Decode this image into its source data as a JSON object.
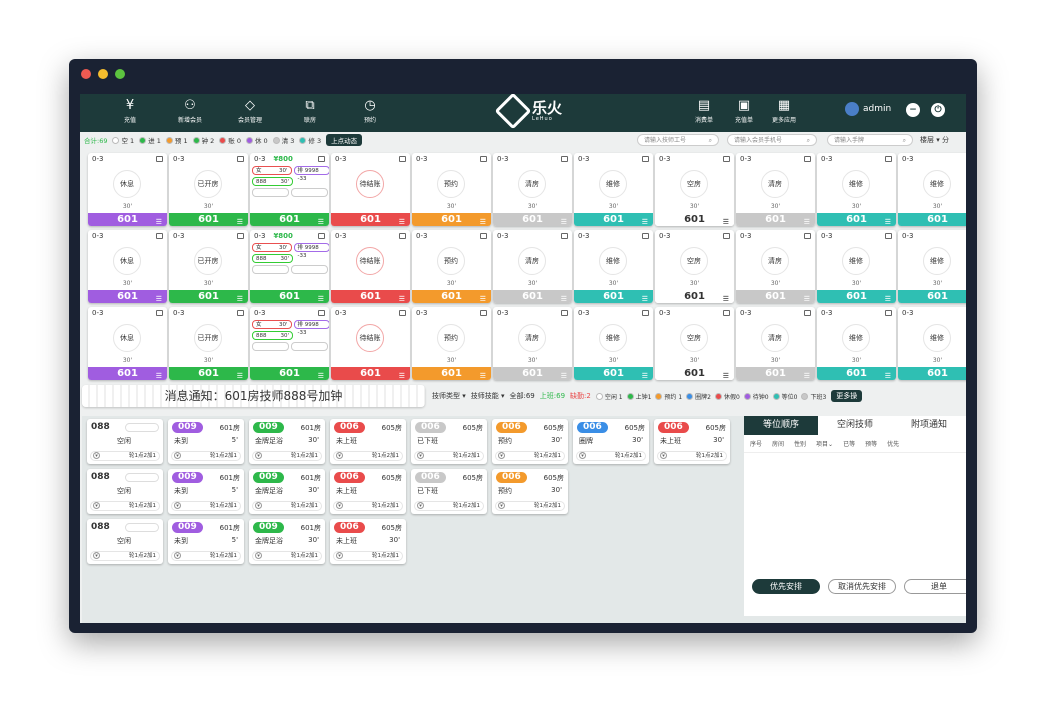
{
  "window": {
    "dot_colors": [
      "#ee5a52",
      "#f5bd2e",
      "#5cc33f"
    ]
  },
  "toolbar": [
    {
      "label": "充值",
      "icon": "yen-icon"
    },
    {
      "label": "新增会员",
      "icon": "add-user-icon"
    },
    {
      "label": "会员管理",
      "icon": "diamond-icon"
    },
    {
      "label": "联房",
      "icon": "link-rooms-icon"
    },
    {
      "label": "预约",
      "icon": "clock-icon"
    }
  ],
  "toolbar_right": [
    {
      "label": "消费单",
      "icon": "receipt-icon"
    },
    {
      "label": "充值单",
      "icon": "recharge-icon"
    },
    {
      "label": "更多应用",
      "icon": "grid-icon"
    }
  ],
  "logo": {
    "name": "乐火",
    "sub": "LeHuo"
  },
  "user": {
    "name": "admin"
  },
  "status_filter": {
    "total": "合计:69",
    "items": [
      {
        "label": "空 1",
        "color": "#ffffff"
      },
      {
        "label": "进 1",
        "color": "#2db84a"
      },
      {
        "label": "预 1",
        "color": "#f39a2c"
      },
      {
        "label": "钟 2",
        "color": "#2db84a"
      },
      {
        "label": "账 0",
        "color": "#e94b4b"
      },
      {
        "label": "休 0",
        "color": "#a05de0"
      },
      {
        "label": "清 3",
        "color": "#c8c8c8"
      },
      {
        "label": "修 3",
        "color": "#2fbfb3"
      }
    ],
    "dynamic": "上点动态"
  },
  "searches": {
    "tech_id": "请输入技师工号",
    "member_phone": "请输入会员手机号",
    "bracelet": "请输入手牌",
    "floor": "楼层",
    "extra": "分"
  },
  "room_rows": [
    [
      {
        "code": "0-3",
        "status": "休息",
        "dur": "30'",
        "room": "601",
        "color": "#a05de0"
      },
      {
        "code": "0-3",
        "status": "已开房",
        "dur": "30'",
        "room": "601",
        "color": "#2db84a"
      },
      {
        "code": "0-3",
        "price": "¥800",
        "guests": true,
        "room": "601",
        "color": "#2db84a"
      },
      {
        "code": "0-3",
        "status": "待结账",
        "room": "601",
        "color": "#e94b4b",
        "red": true
      },
      {
        "code": "0-3",
        "status": "预约",
        "dur": "30'",
        "room": "601",
        "color": "#f39a2c"
      },
      {
        "code": "0-3",
        "status": "清房",
        "dur": "30'",
        "room": "601",
        "color": "#c8c8c8"
      },
      {
        "code": "0-3",
        "status": "维修",
        "dur": "30'",
        "room": "601",
        "color": "#2fbfb3"
      },
      {
        "code": "0-3",
        "status": "空房",
        "dur": "30'",
        "room": "601",
        "color": "#ffffff"
      },
      {
        "code": "0-3",
        "status": "清房",
        "dur": "30'",
        "room": "601",
        "color": "#c8c8c8"
      },
      {
        "code": "0-3",
        "status": "维修",
        "dur": "30'",
        "room": "601",
        "color": "#2fbfb3"
      },
      {
        "code": "0-3",
        "status": "维修",
        "dur": "30'",
        "room": "601",
        "color": "#2fbfb3"
      }
    ],
    [
      {
        "code": "0-3",
        "status": "休息",
        "dur": "30'",
        "room": "601",
        "color": "#a05de0"
      },
      {
        "code": "0-3",
        "status": "已开房",
        "dur": "30'",
        "room": "601",
        "color": "#2db84a"
      },
      {
        "code": "0-3",
        "price": "¥800",
        "guests": true,
        "room": "601",
        "color": "#2db84a"
      },
      {
        "code": "0-3",
        "status": "待结账",
        "room": "601",
        "color": "#e94b4b",
        "red": true
      },
      {
        "code": "0-3",
        "status": "预约",
        "dur": "30'",
        "room": "601",
        "color": "#f39a2c"
      },
      {
        "code": "0-3",
        "status": "清房",
        "dur": "30'",
        "room": "601",
        "color": "#c8c8c8"
      },
      {
        "code": "0-3",
        "status": "维修",
        "dur": "30'",
        "room": "601",
        "color": "#2fbfb3"
      },
      {
        "code": "0-3",
        "status": "空房",
        "dur": "30'",
        "room": "601",
        "color": "#ffffff"
      },
      {
        "code": "0-3",
        "status": "清房",
        "dur": "30'",
        "room": "601",
        "color": "#c8c8c8"
      },
      {
        "code": "0-3",
        "status": "维修",
        "dur": "30'",
        "room": "601",
        "color": "#2fbfb3"
      },
      {
        "code": "0-3",
        "status": "维修",
        "dur": "30'",
        "room": "601",
        "color": "#2fbfb3"
      }
    ],
    [
      {
        "code": "0-3",
        "status": "休息",
        "dur": "30'",
        "room": "601",
        "color": "#a05de0"
      },
      {
        "code": "0-3",
        "status": "已开房",
        "dur": "30'",
        "room": "601",
        "color": "#2db84a"
      },
      {
        "code": "0-3",
        "price": "",
        "guests": true,
        "room": "601",
        "color": "#2db84a"
      },
      {
        "code": "0-3",
        "status": "待结账",
        "room": "601",
        "color": "#e94b4b",
        "red": true
      },
      {
        "code": "0-3",
        "status": "预约",
        "dur": "30'",
        "room": "601",
        "color": "#f39a2c"
      },
      {
        "code": "0-3",
        "status": "清房",
        "dur": "30'",
        "room": "601",
        "color": "#c8c8c8"
      },
      {
        "code": "0-3",
        "status": "维修",
        "dur": "30'",
        "room": "601",
        "color": "#2fbfb3"
      },
      {
        "code": "0-3",
        "status": "空房",
        "dur": "30'",
        "room": "601",
        "color": "#ffffff"
      },
      {
        "code": "0-3",
        "status": "清房",
        "dur": "30'",
        "room": "601",
        "color": "#c8c8c8"
      },
      {
        "code": "0-3",
        "status": "维修",
        "dur": "30'",
        "room": "601",
        "color": "#2fbfb3"
      },
      {
        "code": "0-3",
        "status": "维修",
        "dur": "30'",
        "room": "601",
        "color": "#2fbfb3"
      }
    ]
  ],
  "guest_pills": {
    "g1": "女",
    "g1d": "30'",
    "g2": "排 9998 -33",
    "g3": "888",
    "g3d": "30'"
  },
  "notice": "消息通知：601房技师888号加钟",
  "tech_filter": {
    "type": "技师类型",
    "skill": "技师技能",
    "all": "全部:69",
    "on": "上班:69",
    "absent": "缺勤:2",
    "items": [
      {
        "label": "空闲 1",
        "color": "#ffffff"
      },
      {
        "label": "上钟1",
        "color": "#2db84a"
      },
      {
        "label": "预约 1",
        "color": "#f39a2c"
      },
      {
        "label": "圈牌2",
        "color": "#3a8ee6"
      },
      {
        "label": "休假0",
        "color": "#e94b4b"
      },
      {
        "label": "待钟0",
        "color": "#a05de0"
      },
      {
        "label": "等位0",
        "color": "#2fbfb3"
      },
      {
        "label": "下班3",
        "color": "#c8c8c8"
      }
    ],
    "more": "更多操"
  },
  "tech_rows": [
    [
      {
        "num": "088",
        "status": "空闲",
        "color": "",
        "pill": true
      },
      {
        "num": "009",
        "room": "601房",
        "status": "未到",
        "min": "5'",
        "color": "#a05de0"
      },
      {
        "num": "009",
        "room": "601房",
        "status": "金牌足浴",
        "min": "30'",
        "color": "#2db84a"
      },
      {
        "num": "006",
        "room": "605房",
        "status": "未上班",
        "color": "#e94b4b"
      },
      {
        "num": "006",
        "room": "605房",
        "status": "已下班",
        "color": "#c8c8c8"
      },
      {
        "num": "006",
        "room": "605房",
        "status": "预约",
        "min": "30'",
        "color": "#f39a2c"
      },
      {
        "num": "006",
        "room": "605房",
        "status": "圈牌",
        "min": "30'",
        "color": "#3a8ee6"
      },
      {
        "num": "006",
        "room": "605房",
        "status": "未上班",
        "min": "30'",
        "color": "#e94b4b"
      }
    ],
    [
      {
        "num": "088",
        "status": "空闲",
        "color": "",
        "pill": true
      },
      {
        "num": "009",
        "room": "601房",
        "status": "未到",
        "min": "5'",
        "color": "#a05de0"
      },
      {
        "num": "009",
        "room": "601房",
        "status": "金牌足浴",
        "min": "30'",
        "color": "#2db84a"
      },
      {
        "num": "006",
        "room": "605房",
        "status": "未上班",
        "color": "#e94b4b"
      },
      {
        "num": "006",
        "room": "605房",
        "status": "已下班",
        "color": "#c8c8c8"
      },
      {
        "num": "006",
        "room": "605房",
        "status": "预约",
        "min": "30'",
        "color": "#f39a2c"
      }
    ],
    [
      {
        "num": "088",
        "status": "空闲",
        "color": "",
        "pill": true
      },
      {
        "num": "009",
        "room": "601房",
        "status": "未到",
        "min": "5'",
        "color": "#a05de0"
      },
      {
        "num": "009",
        "room": "601房",
        "status": "金牌足浴",
        "min": "30'",
        "color": "#2db84a"
      },
      {
        "num": "006",
        "room": "605房",
        "status": "未上班",
        "min": "30'",
        "color": "#e94b4b"
      }
    ]
  ],
  "tech_bottom": "轮1点2加1",
  "panel": {
    "tabs": [
      "等位顺序",
      "空闲技师",
      "附项通知"
    ],
    "cols": [
      "序号",
      "房间",
      "性别",
      "项目⌄",
      "已等",
      "预等",
      "优先"
    ],
    "prioritize": "优先安排",
    "cancel": "取消优先安排",
    "cancel_queue": "退单"
  }
}
